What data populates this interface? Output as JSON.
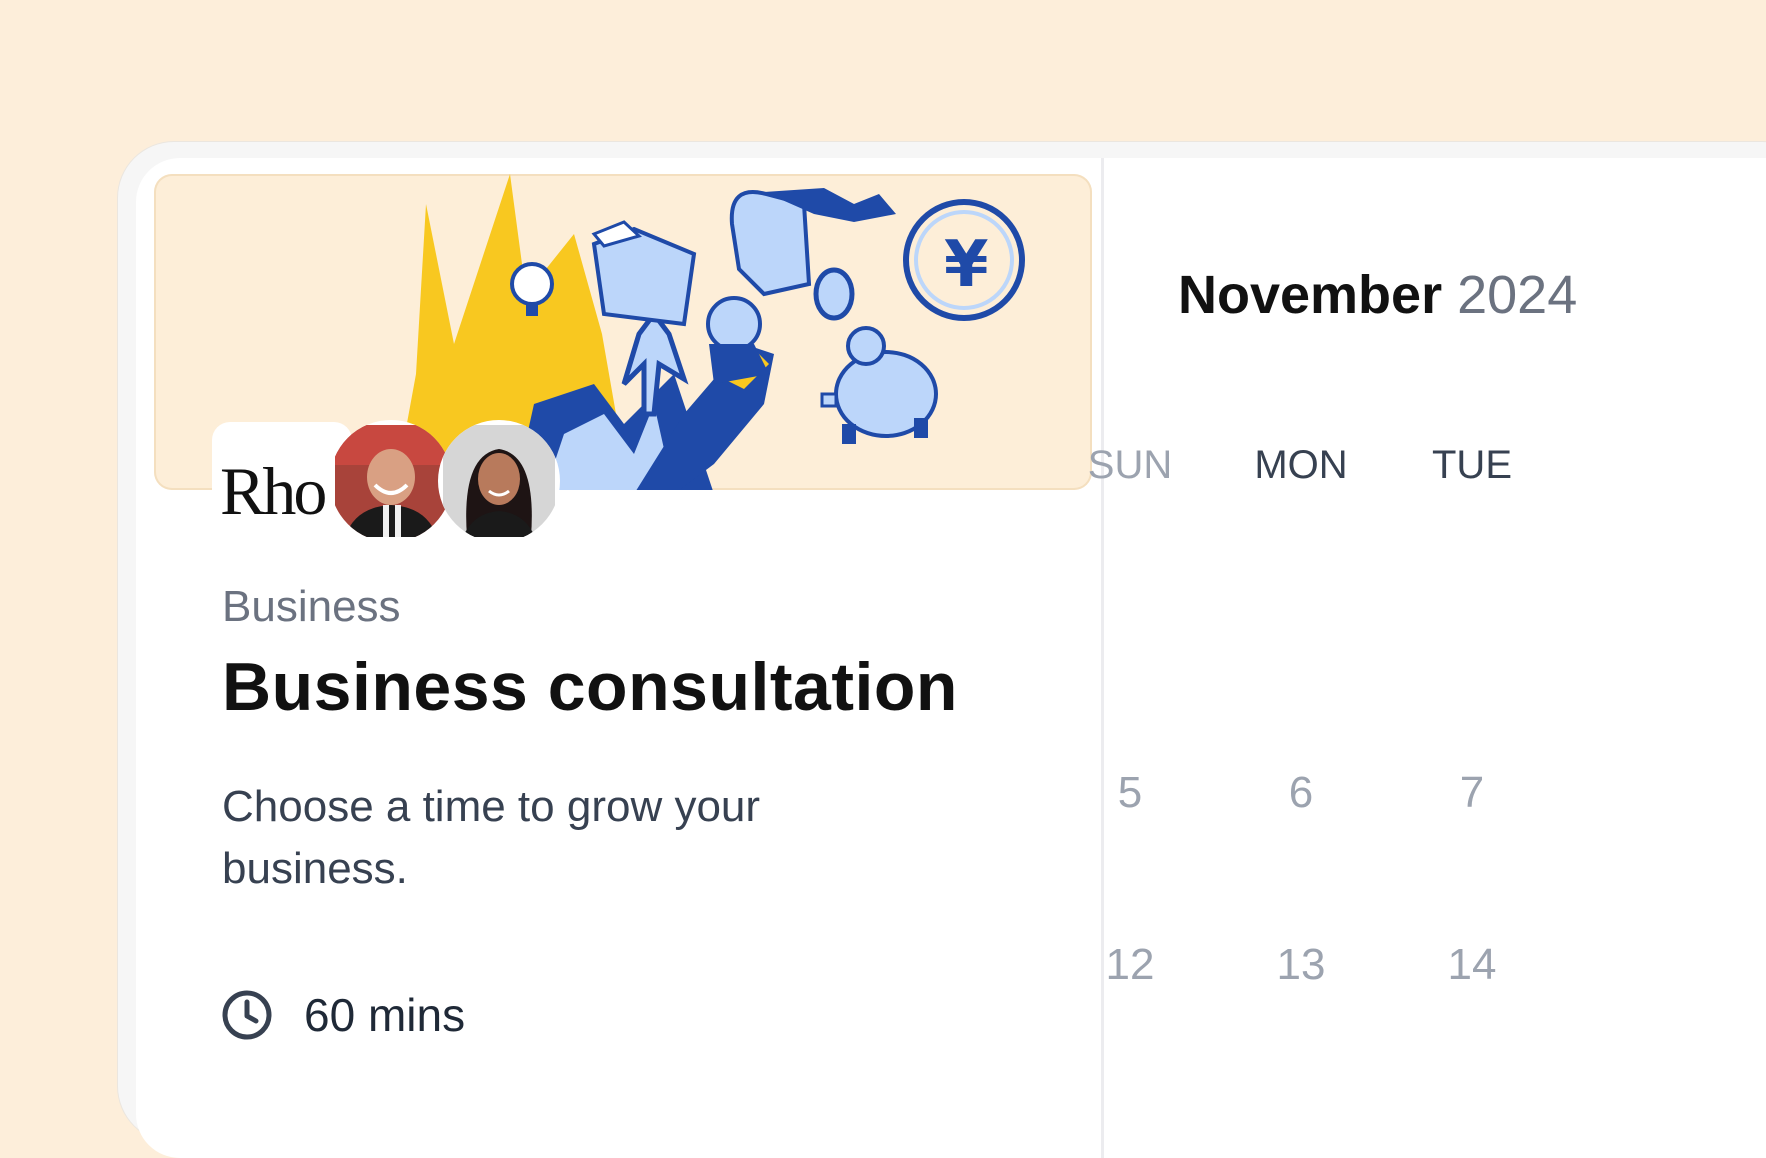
{
  "event": {
    "logo_text": "Rho",
    "category": "Business",
    "title": "Business consultation",
    "description": "Choose a time to grow your business.",
    "duration": "60 mins"
  },
  "calendar": {
    "month": "November",
    "year": "2024",
    "weekdays": [
      "SUN",
      "MON",
      "TUE"
    ],
    "weeks": [
      [
        "5",
        "6",
        "7"
      ],
      [
        "12",
        "13",
        "14"
      ]
    ]
  },
  "colors": {
    "page_background": "#fdeeda",
    "banner_background": "#fdeed8",
    "banner_yellow": "#f8c820",
    "banner_blue": "#1f4aa8",
    "banner_light_blue": "#bcd6fa"
  },
  "icons": {
    "duration": "clock-icon"
  }
}
